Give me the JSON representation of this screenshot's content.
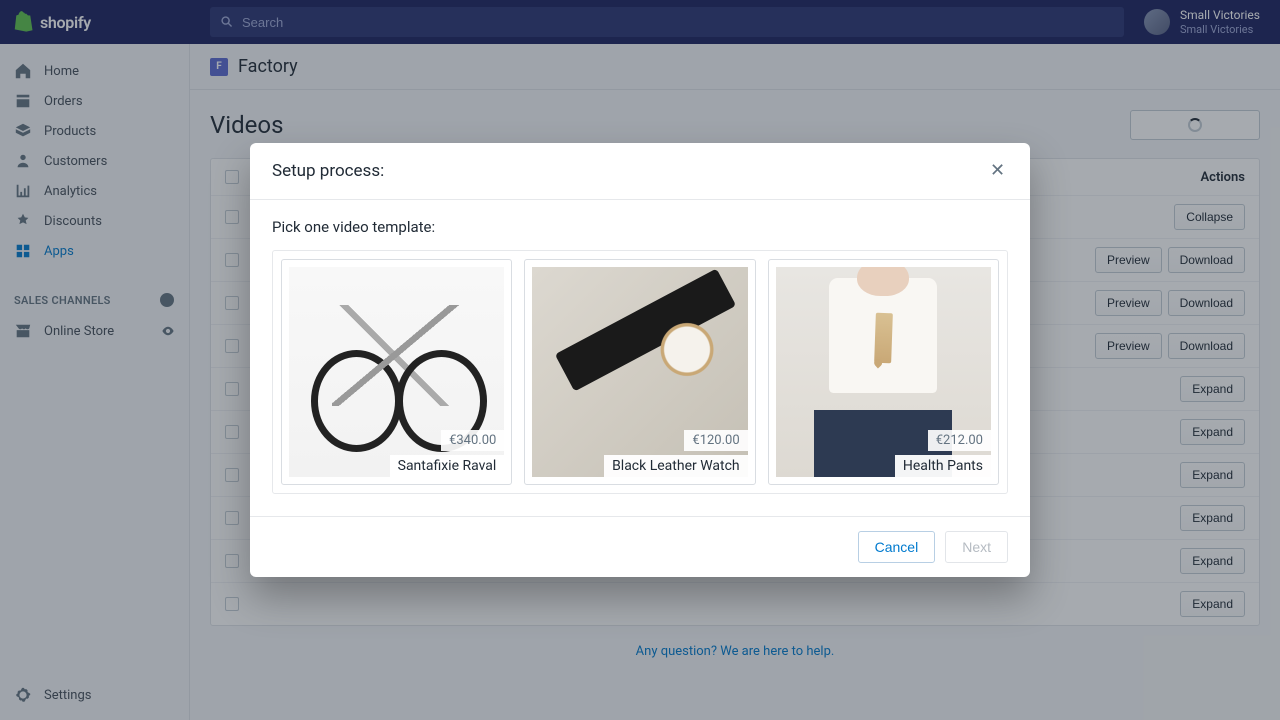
{
  "topbar": {
    "searchPlaceholder": "Search"
  },
  "account": {
    "name": "Small Victories",
    "subtitle": "Small Victories"
  },
  "sidebar": {
    "nav": [
      {
        "label": "Home",
        "icon": "home"
      },
      {
        "label": "Orders",
        "icon": "orders"
      },
      {
        "label": "Products",
        "icon": "products"
      },
      {
        "label": "Customers",
        "icon": "customers"
      },
      {
        "label": "Analytics",
        "icon": "analytics"
      },
      {
        "label": "Discounts",
        "icon": "discounts"
      },
      {
        "label": "Apps",
        "icon": "apps",
        "active": true
      }
    ],
    "salesHeader": "SALES CHANNELS",
    "channels": [
      {
        "label": "Online Store"
      }
    ],
    "settings": "Settings"
  },
  "page": {
    "badge": "F",
    "title": "Factory",
    "section": "Videos"
  },
  "table": {
    "actionsHeader": "Actions",
    "rows": [
      {
        "type": "collapse",
        "btn": "Collapse"
      },
      {
        "type": "pd",
        "preview": "Preview",
        "download": "Download"
      },
      {
        "type": "pd",
        "preview": "Preview",
        "download": "Download"
      },
      {
        "type": "pd",
        "preview": "Preview",
        "download": "Download"
      },
      {
        "type": "expand",
        "btn": "Expand"
      },
      {
        "type": "expand",
        "btn": "Expand"
      },
      {
        "type": "expand",
        "btn": "Expand"
      },
      {
        "type": "expand",
        "btn": "Expand"
      },
      {
        "type": "expand",
        "btn": "Expand"
      },
      {
        "type": "expand",
        "btn": "Expand"
      }
    ]
  },
  "footerHelp": "Any question? We are here to help.",
  "modal": {
    "title": "Setup process:",
    "subtitle": "Pick one video template:",
    "templates": [
      {
        "price": "€340.00",
        "name": "Santafixie Raval",
        "img": "bike"
      },
      {
        "price": "€120.00",
        "name": "Black Leather Watch",
        "img": "watch"
      },
      {
        "price": "€212.00",
        "name": "Health Pants",
        "img": "model"
      }
    ],
    "cancel": "Cancel",
    "next": "Next"
  }
}
